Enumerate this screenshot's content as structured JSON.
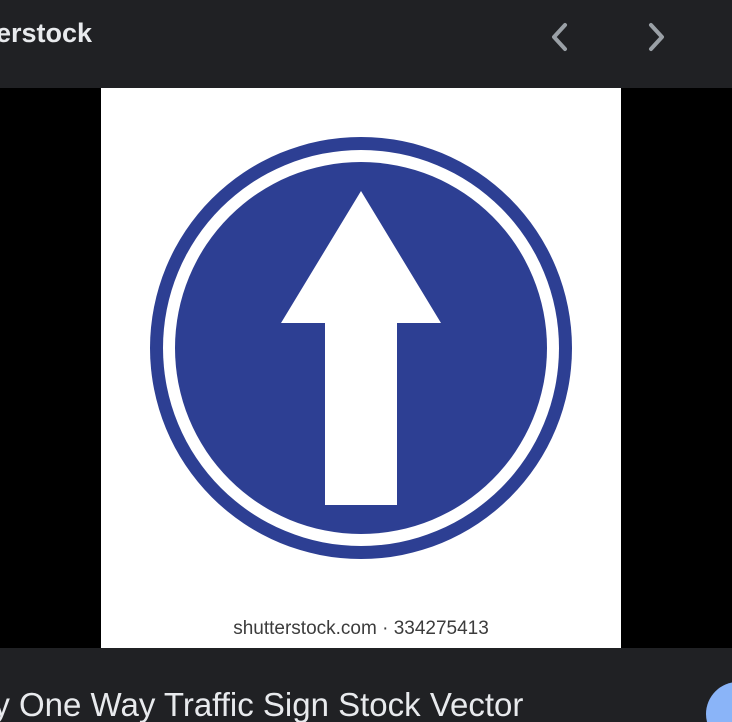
{
  "header": {
    "source_name": "erstock",
    "prev_icon": "chevron-left-icon",
    "next_icon": "chevron-right-icon"
  },
  "image": {
    "watermark": "shutterstock.com · 334275413",
    "sign_icon": "one-way-arrow-sign",
    "sign_color": "#2d3f93",
    "background_color": "#ffffff"
  },
  "footer": {
    "title": "ly One Way Traffic Sign Stock Vector",
    "action_color": "#8ab4f8"
  }
}
